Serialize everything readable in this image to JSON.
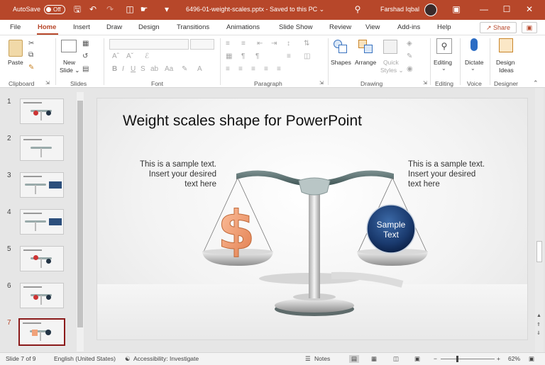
{
  "titlebar": {
    "autosave_label": "AutoSave",
    "autosave_state": "Off",
    "document_title": "6496-01-weight-scales.pptx  -  Saved to this PC ⌄",
    "user_name": "Farshad Iqbal",
    "accent_color": "#b7472a"
  },
  "menu": {
    "items": [
      "File",
      "Home",
      "Insert",
      "Draw",
      "Design",
      "Transitions",
      "Animations",
      "Slide Show",
      "Review",
      "View",
      "Add-ins",
      "Help"
    ],
    "active": "Home",
    "share_label": "Share"
  },
  "ribbon": {
    "clipboard": {
      "label": "Clipboard",
      "paste": "Paste"
    },
    "slides": {
      "label": "Slides",
      "new_slide": "New",
      "new_slide_2": "Slide ⌄"
    },
    "font": {
      "label": "Font"
    },
    "paragraph": {
      "label": "Paragraph"
    },
    "drawing": {
      "label": "Drawing",
      "shapes": "Shapes",
      "arrange": "Arrange",
      "quick_styles": "Quick",
      "quick_styles_2": "Styles ⌄"
    },
    "editing": {
      "label": "Editing",
      "editing_btn": "Editing"
    },
    "voice": {
      "label": "Voice",
      "dictate": "Dictate"
    },
    "designer": {
      "label": "Designer",
      "design_ideas": "Design",
      "design_ideas_2": "Ideas"
    }
  },
  "thumbnails": {
    "numbers": [
      "1",
      "2",
      "3",
      "4",
      "5",
      "6",
      "7"
    ],
    "selected": "7"
  },
  "slide": {
    "title": "Weight scales shape for PowerPoint",
    "left_text": [
      "This is a sample text.",
      "Insert your desired",
      "text here"
    ],
    "right_text": [
      "This is a sample text.",
      "Insert your desired",
      "text here"
    ],
    "circle_text": [
      "Sample",
      "Text"
    ],
    "dollar_symbol": "$"
  },
  "status": {
    "slide_info": "Slide 7 of 9",
    "language": "English (United States)",
    "accessibility": "Accessibility: Investigate",
    "notes": "Notes",
    "zoom": "62%"
  }
}
